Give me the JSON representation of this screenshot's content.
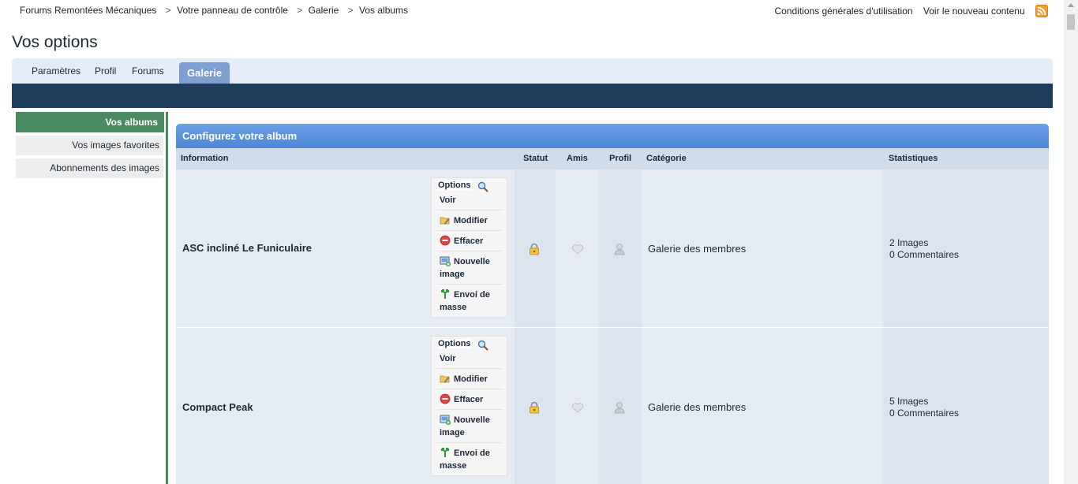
{
  "breadcrumb": [
    "Forums Remontées Mécaniques",
    "Votre panneau de contrôle",
    "Galerie",
    "Vos albums"
  ],
  "breadcrumb_sep": ">",
  "top_links": [
    "Conditions générales d'utilisation",
    "Voir le nouveau contenu"
  ],
  "page_title": "Vos options",
  "tabs": [
    "Paramètres",
    "Profil",
    "Forums",
    "Galerie"
  ],
  "sidebar": [
    "Vos albums",
    "Vos images favorites",
    "Abonnements des images"
  ],
  "panel_title": "Configurez votre album",
  "columns": [
    "Information",
    "Statut",
    "Amis",
    "Profil",
    "Catégorie",
    "Statistiques"
  ],
  "options_label": "Options",
  "menu": {
    "view": "Voir",
    "edit": "Modifier",
    "delete": "Effacer",
    "new_image_1": "Nouvelle",
    "new_image_2": "image",
    "mass_upload_1": "Envoi de",
    "mass_upload_2": "masse"
  },
  "albums": [
    {
      "title": "ASC incliné Le Funiculaire",
      "category": "Galerie des membres",
      "images": "2 Images",
      "comments": "0 Commentaires"
    },
    {
      "title": "Compact Peak",
      "category": "Galerie des membres",
      "images": "5 Images",
      "comments": "0 Commentaires"
    }
  ],
  "colors": {
    "nav": "#1f3e5d",
    "tab_active": "#7d9fd1",
    "sidebar_active": "#4a8a63",
    "panel_header": "#5a92dc"
  }
}
